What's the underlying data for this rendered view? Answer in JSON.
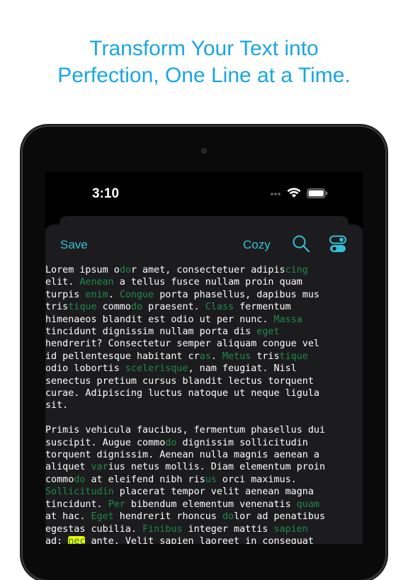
{
  "headline": {
    "line1": "Transform Your Text into",
    "line2": "Perfection, One Line at a Time."
  },
  "status_bar": {
    "time": "3:10",
    "icons": [
      "signal-dots-icon",
      "wifi-icon",
      "battery-icon"
    ]
  },
  "toolbar": {
    "save_label": "Save",
    "cozy_label": "Cozy",
    "search_icon": "search-icon",
    "toggle_icon": "settings-toggle-icon"
  },
  "colors": {
    "headline": "#1aa6e0",
    "accent": "#34c0d6",
    "marked_text": "#1f8a4a",
    "highlight": "#f2f30a",
    "sheet": "#1c1c1e"
  },
  "editor": {
    "paragraphs": [
      [
        [
          {
            "t": "Lorem ipsum o"
          },
          {
            "t": "do",
            "m": 1
          },
          {
            "t": "r amet, consectetuer adipis"
          },
          {
            "t": "cing",
            "m": 1
          }
        ],
        [
          {
            "t": "elit. "
          },
          {
            "t": "Aenean",
            "m": 1
          },
          {
            "t": " a tellus fusce nullam proin quam"
          }
        ],
        [
          {
            "t": "turpis "
          },
          {
            "t": "enim",
            "m": 1
          },
          {
            "t": ". "
          },
          {
            "t": "Congue",
            "m": 1
          },
          {
            "t": " porta phasellus, dapibus mus"
          }
        ],
        [
          {
            "t": "tris"
          },
          {
            "t": "tique",
            "m": 1
          },
          {
            "t": " commo"
          },
          {
            "t": "do",
            "m": 1
          },
          {
            "t": " praesent. "
          },
          {
            "t": "Class",
            "m": 1
          },
          {
            "t": " fermentum"
          }
        ],
        [
          {
            "t": "himenaeos blandit est odio ut per nunc. "
          },
          {
            "t": "Massa",
            "m": 1
          }
        ],
        [
          {
            "t": "tincidunt dignissim nullam porta dis "
          },
          {
            "t": "eget",
            "m": 1
          }
        ],
        [
          {
            "t": "hendrerit? Consectetur semper aliquam congue vel"
          }
        ],
        [
          {
            "t": "id pellentesque habitant cr"
          },
          {
            "t": "as",
            "m": 1
          },
          {
            "t": ". "
          },
          {
            "t": "Metus",
            "m": 1
          },
          {
            "t": " tris"
          },
          {
            "t": "tique",
            "m": 1
          }
        ],
        [
          {
            "t": "odio lobortis "
          },
          {
            "t": "scelerisque",
            "m": 1
          },
          {
            "t": ", nam feugiat. Nisl"
          }
        ],
        [
          {
            "t": "senectus pretium cursus blandit lectus torquent"
          }
        ],
        [
          {
            "t": "curae. Adipiscing luctus natoque ut neque ligula"
          }
        ],
        [
          {
            "t": "sit."
          }
        ]
      ],
      [
        [
          {
            "t": "Primis vehicula faucibus, fermentum phasellus dui"
          }
        ],
        [
          {
            "t": "suscipit. Augue commo"
          },
          {
            "t": "do",
            "m": 1
          },
          {
            "t": " dignissim sollicitudin"
          }
        ],
        [
          {
            "t": "torquent dignissim. Aenean nulla magnis aenean a"
          }
        ],
        [
          {
            "t": "aliquet "
          },
          {
            "t": "var",
            "m": 1
          },
          {
            "t": "ius netus mollis. Diam elementum proin"
          }
        ],
        [
          {
            "t": "commo"
          },
          {
            "t": "do",
            "m": 1
          },
          {
            "t": " at eleifend nibh ris"
          },
          {
            "t": "us",
            "m": 1
          },
          {
            "t": " orci maximus."
          }
        ],
        [
          {
            "t": "Sollicitudin",
            "m": 1
          },
          {
            "t": " placerat tempor velit aenean magna"
          }
        ],
        [
          {
            "t": "tincidunt. "
          },
          {
            "t": "Per",
            "m": 1
          },
          {
            "t": " bibendum elementum venenatis "
          },
          {
            "t": "quam",
            "m": 1
          }
        ],
        [
          {
            "t": "at hac. "
          },
          {
            "t": "Eget",
            "m": 1
          },
          {
            "t": " hendrerit rhoncus "
          },
          {
            "t": "do",
            "m": 1
          },
          {
            "t": "lor ad penatibus"
          }
        ],
        [
          {
            "t": "egestas cubilia. "
          },
          {
            "t": "Finibus",
            "m": 1
          },
          {
            "t": " integer mattis "
          },
          {
            "t": "sapien",
            "m": 1
          }
        ],
        [
          {
            "t": "ad: "
          },
          {
            "t": "nec",
            "m": 2
          },
          {
            "t": " ante. Velit sapien laoreet in consequat"
          }
        ]
      ]
    ]
  }
}
